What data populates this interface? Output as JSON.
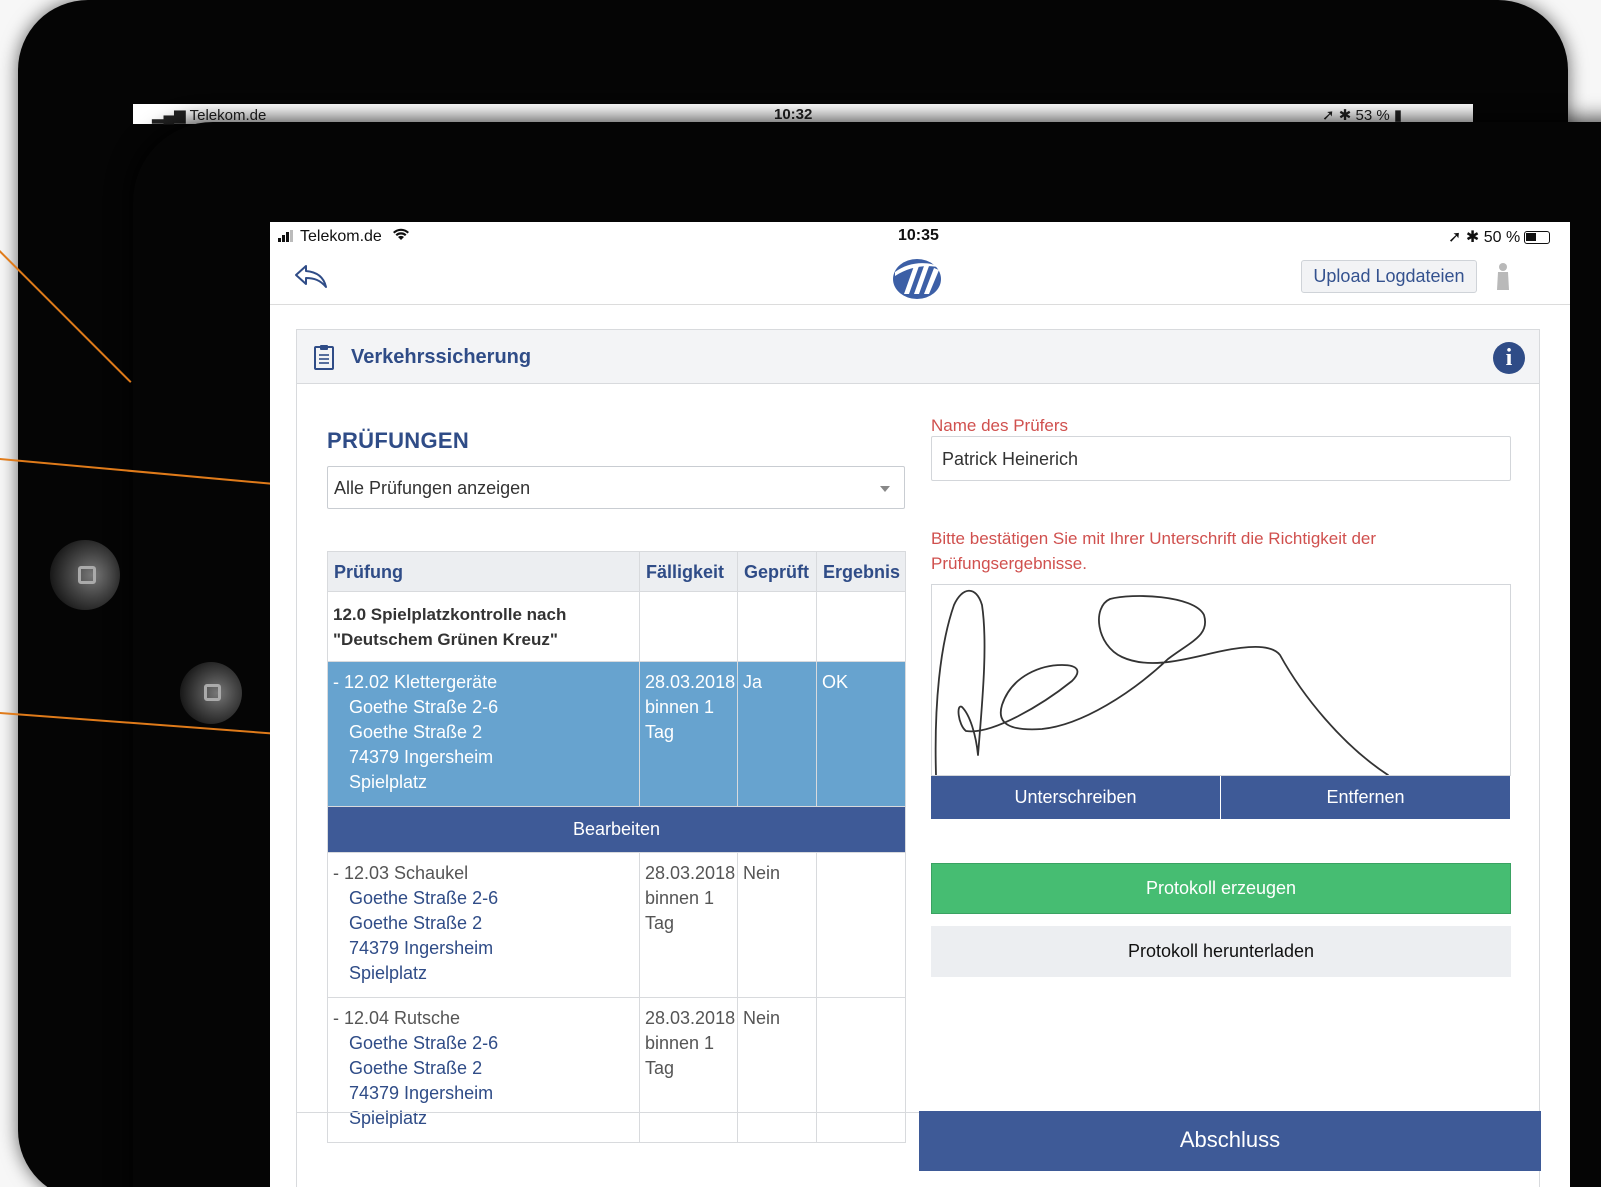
{
  "back_device": {
    "carrier": "Telekom.de",
    "time": "10:32",
    "battery": "53 %"
  },
  "status": {
    "carrier": "Telekom.de",
    "time": "10:35",
    "battery": "50 %"
  },
  "nav": {
    "upload_label": "Upload Logdateien"
  },
  "card": {
    "title": "Verkehrssicherung"
  },
  "tests": {
    "section_title": "PRÜFUNGEN",
    "filter_value": "Alle Prüfungen anzeigen",
    "columns": [
      "Prüfung",
      "Fälligkeit",
      "Geprüft",
      "Ergebnis"
    ],
    "group": {
      "line1": "12.0 Spielplatzkontrolle nach",
      "line2": "\"Deutschem Grünen Kreuz\""
    },
    "rows": [
      {
        "name": "- 12.02 Klettergeräte",
        "address": [
          "Goethe Straße 2-6",
          "Goethe Straße 2",
          "74379 Ingersheim",
          "Spielplatz"
        ],
        "due_date": "28.03.2018",
        "due_line2": "binnen 1",
        "due_line3": "Tag",
        "checked": "Ja",
        "result": "OK"
      },
      {
        "name": "- 12.03 Schaukel",
        "address": [
          "Goethe Straße 2-6",
          "Goethe Straße 2",
          "74379 Ingersheim",
          "Spielplatz"
        ],
        "due_date": "28.03.2018",
        "due_line2": "binnen 1",
        "due_line3": "Tag",
        "checked": "Nein",
        "result": ""
      },
      {
        "name": "- 12.04 Rutsche",
        "address": [
          "Goethe Straße 2-6",
          "Goethe Straße 2",
          "74379 Ingersheim",
          "Spielplatz"
        ],
        "due_date": "28.03.2018",
        "due_line2": "binnen 1",
        "due_line3": "Tag",
        "checked": "Nein",
        "result": ""
      }
    ],
    "edit_label": "Bearbeiten"
  },
  "inspector": {
    "label": "Name des Prüfers",
    "value": "Patrick Heinerich",
    "sign_hint": "Bitte bestätigen Sie mit Ihrer Unterschrift die Richtigkeit der Prüfungsergebnisse.",
    "sign_label": "Unterschreiben",
    "remove_label": "Entfernen",
    "protocol_label": "Protokoll erzeugen",
    "download_label": "Protokoll herunterladen"
  },
  "footer": {
    "finish_label": "Abschluss"
  },
  "colors": {
    "primary": "#3e5a97",
    "title": "#2f4c87",
    "selected_row": "#67a3cf",
    "success": "#46bd72",
    "warning_text": "#d0504e",
    "callout": "#e07b1a"
  }
}
